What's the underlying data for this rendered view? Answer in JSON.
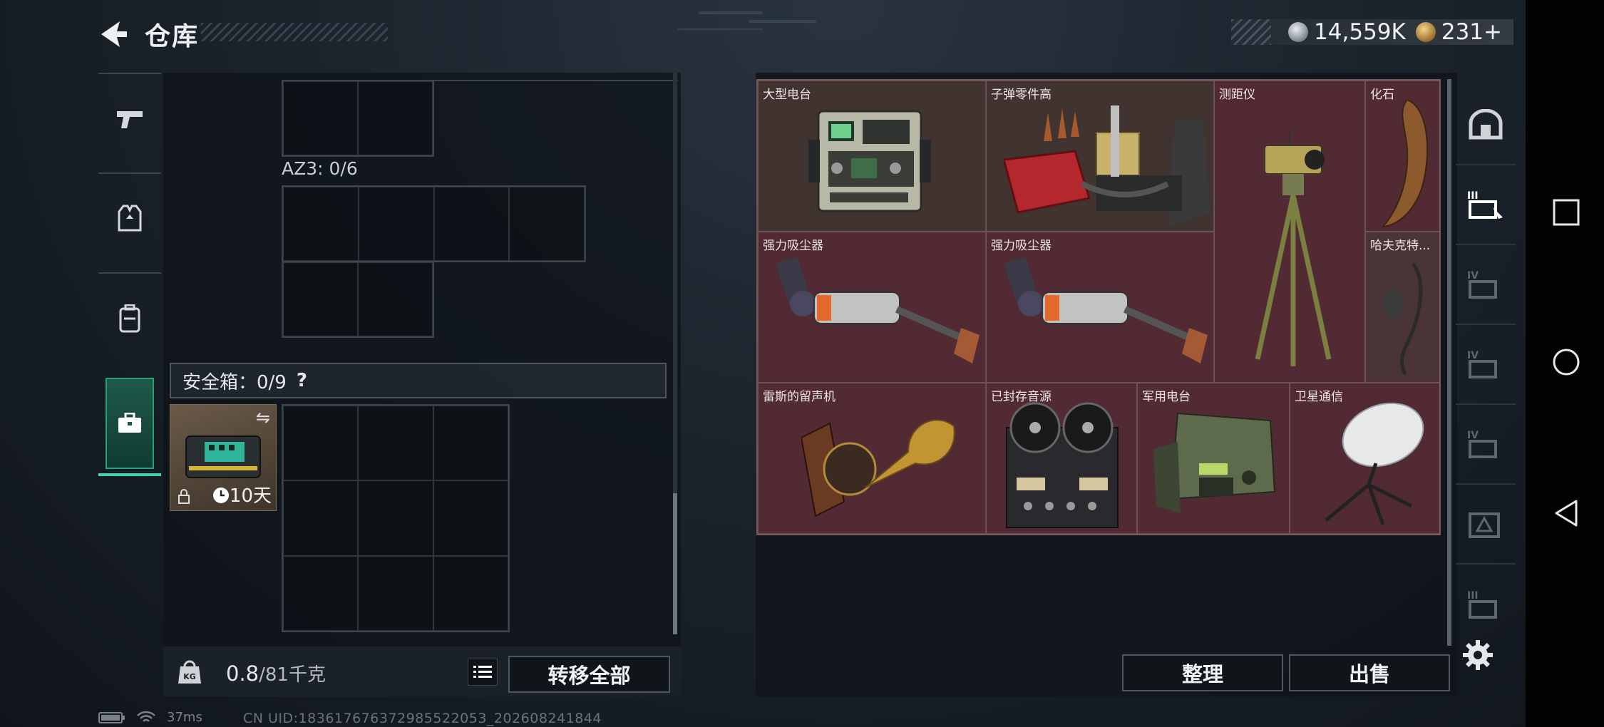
{
  "header": {
    "title": "仓库",
    "back_icon": "back-arrow-icon"
  },
  "currency": {
    "silver": "14,559K",
    "gold": "231+"
  },
  "left_tabs": [
    {
      "name": "weapon",
      "icon": "pistol-icon"
    },
    {
      "name": "armor",
      "icon": "vest-icon"
    },
    {
      "name": "backpack",
      "icon": "backpack-icon"
    },
    {
      "name": "safebox",
      "icon": "briefcase-icon",
      "active": true
    }
  ],
  "containers": {
    "az3_label": "AZ3: 0/6",
    "safe_header": "安全箱：0/9",
    "safe_help": "?",
    "safebox_item": {
      "days": "10天"
    }
  },
  "bottom_left": {
    "weight_current": "0.8",
    "weight_cap": "/81千克",
    "transfer_all": "转移全部"
  },
  "stash_items": [
    {
      "name": "大型电台",
      "color": "brown"
    },
    {
      "name": "子弹零件高",
      "color": "brown"
    },
    {
      "name": "测距仪",
      "color": "red"
    },
    {
      "name": "化石",
      "color": "red"
    },
    {
      "name": "强力吸尘器",
      "color": "red"
    },
    {
      "name": "强力吸尘器",
      "color": "red"
    },
    {
      "name": "哈夫克特...",
      "color": "red"
    },
    {
      "name": "雷斯的留声机",
      "color": "red"
    },
    {
      "name": "已封存音源",
      "color": "red"
    },
    {
      "name": "军用电台",
      "color": "red"
    },
    {
      "name": "卫星通信",
      "color": "red"
    }
  ],
  "bottom_right": {
    "sort": "整理",
    "sell": "出售"
  },
  "status": {
    "ping": "37ms",
    "uid": "CN UID:183617676372985522053_202608241844"
  },
  "colors": {
    "accent": "#46d1a6",
    "item_red": "#512a33",
    "item_brown": "#413330"
  }
}
